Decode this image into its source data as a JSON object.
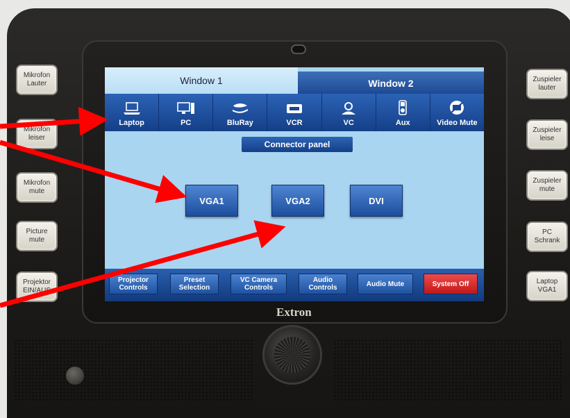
{
  "device": {
    "brand": "Extron"
  },
  "left_buttons": [
    "Mikrofon\nLauter",
    "Mikrofon\nleiser",
    "Mikrofon\nmute",
    "Picture\nmute",
    "Projektor\nEIN/AUS"
  ],
  "right_buttons": [
    "Zuspieler\nlauter",
    "Zuspieler\nleise",
    "Zuspieler\nmute",
    "PC\nSchrank",
    "Laptop\nVGA1"
  ],
  "tabs": {
    "window1": "Window 1",
    "window2": "Window 2"
  },
  "sources": [
    {
      "label": "Laptop",
      "icon": "laptop-icon"
    },
    {
      "label": "PC",
      "icon": "pc-icon"
    },
    {
      "label": "BluRay",
      "icon": "bluray-icon"
    },
    {
      "label": "VCR",
      "icon": "vcr-icon"
    },
    {
      "label": "VC",
      "icon": "video-conference-icon"
    },
    {
      "label": "Aux",
      "icon": "ipod-icon"
    },
    {
      "label": "Video Mute",
      "icon": "video-mute-icon"
    }
  ],
  "connector_panel": {
    "title": "Connector panel",
    "buttons": [
      "VGA1",
      "VGA2",
      "DVI"
    ]
  },
  "bottom_bar": [
    "Projector\nControls",
    "Preset\nSelection",
    "VC Camera\nControls",
    "Audio\nControls",
    "Audio Mute",
    "System Off"
  ],
  "colors": {
    "annotation_arrow": "#ff0000",
    "system_off": "#d42020",
    "screen_bg": "#a9d5f0",
    "bar_blue": "#1b4791"
  }
}
